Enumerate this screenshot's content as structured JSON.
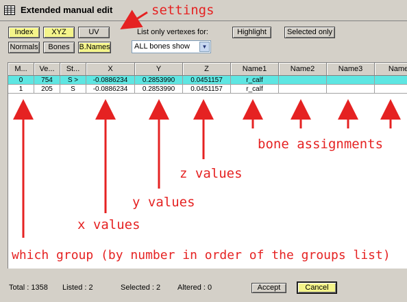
{
  "window": {
    "title": "Extended manual edit"
  },
  "toolbar": {
    "index": "Index",
    "xyz": "XYZ",
    "uv": "UV",
    "normals": "Normals",
    "bones": "Bones",
    "bnames": "B.Names",
    "list_label": "List only vertexes for:",
    "highlight": "Highlight",
    "selected_only": "Selected only",
    "dropdown_value": "ALL bones show"
  },
  "table": {
    "headers": [
      "M...",
      "Ve...",
      "St...",
      "X",
      "Y",
      "Z",
      "Name1",
      "Name2",
      "Name3",
      "Name"
    ],
    "rows": [
      [
        "0",
        "754",
        "S >",
        "-0.0886234",
        "0.2853990",
        "0.0451157",
        "r_calf",
        "",
        "",
        ""
      ],
      [
        "1",
        "205",
        "S",
        "-0.0886234",
        "0.2853990",
        "0.0451157",
        "r_calf",
        "",
        "",
        ""
      ]
    ]
  },
  "annotations": {
    "settings": "settings",
    "bone_assignments": "bone assignments",
    "z_values": "z values",
    "y_values": "y values",
    "x_values": "x values",
    "which_group": "which group (by number in order of the groups list)"
  },
  "status": {
    "total": "Total : 1358",
    "listed": "Listed : 2",
    "selected": "Selected : 2",
    "altered": "Altered : 0",
    "accept": "Accept",
    "cancel": "Cancel"
  },
  "colors": {
    "selected_row": "#5ee6e2",
    "toggle_on": "#f4f48a",
    "annotation": "#e52222"
  }
}
